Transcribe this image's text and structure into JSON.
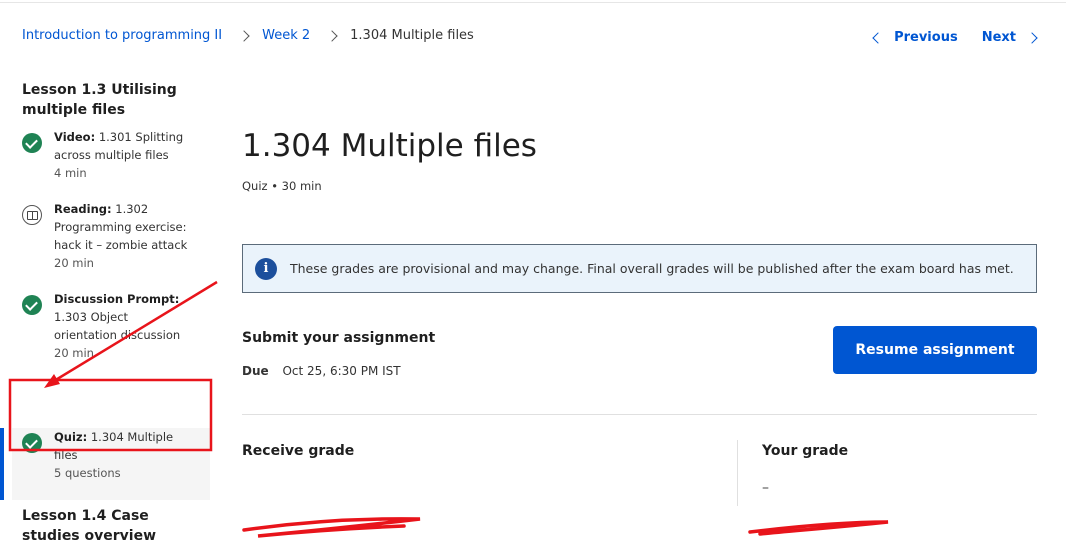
{
  "breadcrumb": {
    "course": "Introduction to programming II",
    "week": "Week 2",
    "current": "1.304 Multiple files"
  },
  "pager": {
    "previous": "Previous",
    "next": "Next"
  },
  "sidebar": {
    "lesson_current": "Lesson 1.3 Utilising multiple files",
    "lesson_next": "Lesson 1.4 Case studies overview",
    "items": [
      {
        "type": "Video:",
        "title": "1.301 Splitting across multiple files",
        "meta": "4 min",
        "status": "check-icon"
      },
      {
        "type": "Reading:",
        "title": "1.302 Programming exercise: hack it – zombie attack",
        "meta": "20 min",
        "status": "book-icon"
      },
      {
        "type": "Discussion Prompt:",
        "title": "1.303 Object orientation discussion",
        "meta": "20 min",
        "status": "check-icon"
      },
      {
        "type": "Quiz:",
        "title": "1.304 Multiple files",
        "meta": "5 questions",
        "status": "check-icon"
      }
    ]
  },
  "main": {
    "title": "1.304 Multiple files",
    "subtitle": "Quiz • 30 min",
    "notice": "These grades are provisional and may change. Final overall grades will be published after the exam board has met.",
    "submit_title": "Submit your assignment",
    "due_label": "Due",
    "due_value": "Oct 25, 6:30 PM IST",
    "resume_button": "Resume assignment",
    "receive_grade": "Receive grade",
    "your_grade": "Your grade",
    "your_grade_value": "–"
  },
  "colors": {
    "accent": "#0056d2",
    "success": "#1f8354",
    "annotation": "#e8141b"
  }
}
